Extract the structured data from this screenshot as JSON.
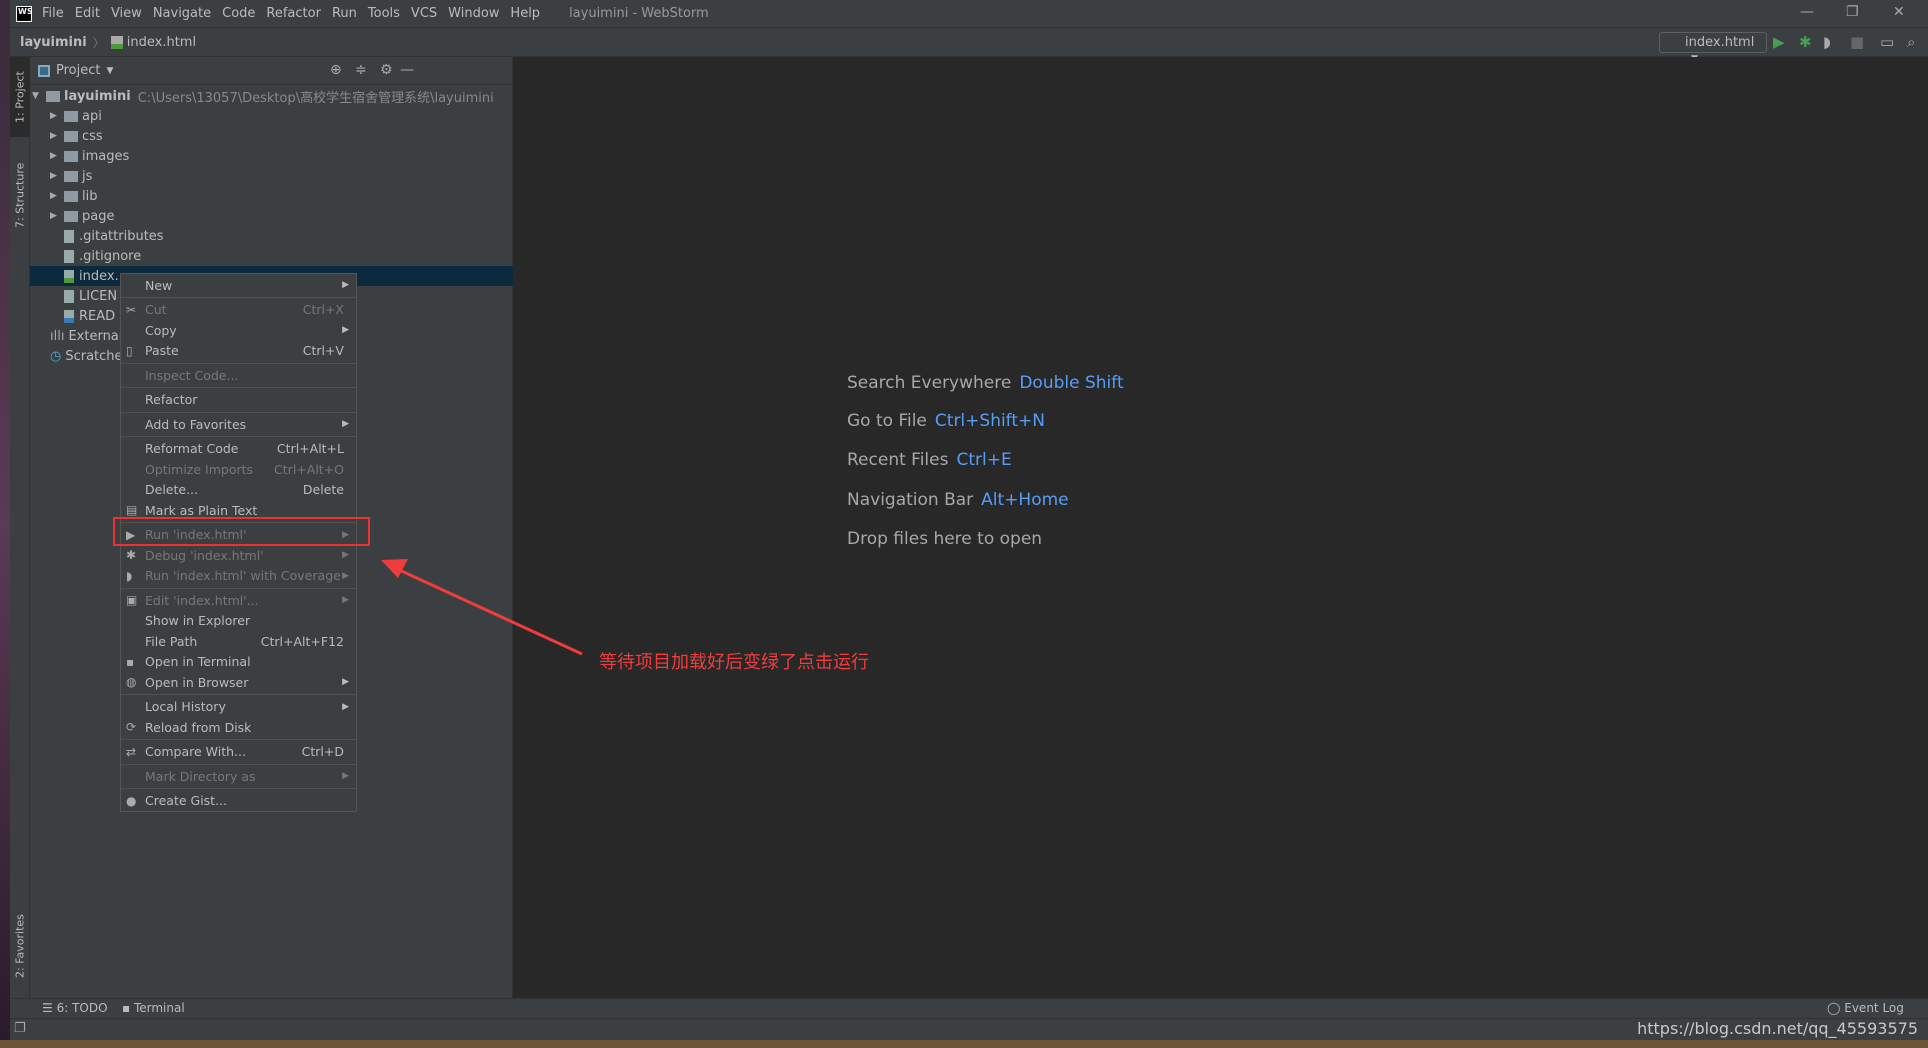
{
  "window": {
    "title": "layuimini - WebStorm",
    "logo": "WS",
    "menu": [
      "File",
      "Edit",
      "View",
      "Navigate",
      "Code",
      "Refactor",
      "Run",
      "Tools",
      "VCS",
      "Window",
      "Help"
    ]
  },
  "navbar": {
    "breadcrumb": [
      "layuimini",
      "index.html"
    ],
    "run_config": "index.html"
  },
  "toolstrip": {
    "project": "1: Project",
    "structure": "7: Structure",
    "favorites": "2: Favorites"
  },
  "project": {
    "header": "Project",
    "root": {
      "name": "layuimini",
      "path": "C:\\Users\\13057\\Desktop\\高校学生宿舍管理系统\\layuimini"
    },
    "items": [
      {
        "name": "api",
        "type": "folder"
      },
      {
        "name": "css",
        "type": "folder"
      },
      {
        "name": "images",
        "type": "folder"
      },
      {
        "name": "js",
        "type": "folder"
      },
      {
        "name": "lib",
        "type": "folder"
      },
      {
        "name": "page",
        "type": "folder"
      },
      {
        "name": ".gitattributes",
        "type": "file"
      },
      {
        "name": ".gitignore",
        "type": "file"
      },
      {
        "name": "index.",
        "type": "html",
        "selected": true
      },
      {
        "name": "LICEN",
        "type": "file"
      },
      {
        "name": "READ",
        "type": "md"
      }
    ],
    "external": "External",
    "scratches": "Scratches"
  },
  "context_menu": [
    {
      "label": "New",
      "arrow": true
    },
    "sep",
    {
      "label": "Cut",
      "shortcut": "Ctrl+X",
      "disabled": true,
      "icon": "✂"
    },
    {
      "label": "Copy",
      "arrow": true
    },
    {
      "label": "Paste",
      "shortcut": "Ctrl+V",
      "icon": "▯"
    },
    "sep",
    {
      "label": "Inspect Code...",
      "disabled": true
    },
    "sep",
    {
      "label": "Refactor"
    },
    "sep",
    {
      "label": "Add to Favorites",
      "arrow": true
    },
    "sep",
    {
      "label": "Reformat Code",
      "shortcut": "Ctrl+Alt+L"
    },
    {
      "label": "Optimize Imports",
      "shortcut": "Ctrl+Alt+O",
      "disabled": true
    },
    {
      "label": "Delete...",
      "shortcut": "Delete"
    },
    {
      "label": "Mark as Plain Text",
      "icon": "▤"
    },
    "sep",
    {
      "label": "Run 'index.html'",
      "disabled": true,
      "arrow": true,
      "icon": "▶"
    },
    {
      "label": "Debug 'index.html'",
      "disabled": true,
      "arrow": true,
      "icon": "✱"
    },
    {
      "label": "Run 'index.html' with Coverage",
      "disabled": true,
      "arrow": true,
      "icon": "◗"
    },
    "sep",
    {
      "label": "Edit 'index.html'...",
      "disabled": true,
      "arrow": true,
      "icon": "▣"
    },
    {
      "label": "Show in Explorer"
    },
    {
      "label": "File Path",
      "shortcut": "Ctrl+Alt+F12"
    },
    {
      "label": "Open in Terminal",
      "icon": "▪"
    },
    {
      "label": "Open in Browser",
      "arrow": true,
      "icon": "◍"
    },
    "sep",
    {
      "label": "Local History",
      "arrow": true
    },
    {
      "label": "Reload from Disk",
      "icon": "⟳"
    },
    "sep",
    {
      "label": "Compare With...",
      "shortcut": "Ctrl+D",
      "icon": "⇄"
    },
    "sep",
    {
      "label": "Mark Directory as",
      "disabled": true,
      "arrow": true
    },
    "sep",
    {
      "label": "Create Gist...",
      "icon": "●"
    }
  ],
  "editor": {
    "hints": [
      {
        "label": "Search Everywhere",
        "key": "Double Shift"
      },
      {
        "label": "Go to File",
        "key": "Ctrl+Shift+N"
      },
      {
        "label": "Recent Files",
        "key": "Ctrl+E"
      },
      {
        "label": "Navigation Bar",
        "key": "Alt+Home"
      },
      {
        "label": "Drop files here to open",
        "key": ""
      }
    ]
  },
  "annotation": {
    "text": "等待项目加载好后变绿了点击运行",
    "color": "#f03c3c"
  },
  "bottom": {
    "todo": "6: TODO",
    "terminal": "Terminal",
    "event_log": "Event Log"
  },
  "watermark": "https://blog.csdn.net/qq_45593575",
  "colors": {
    "run_green": "#499c54",
    "link_blue": "#589df6",
    "selection": "#0d293e"
  }
}
